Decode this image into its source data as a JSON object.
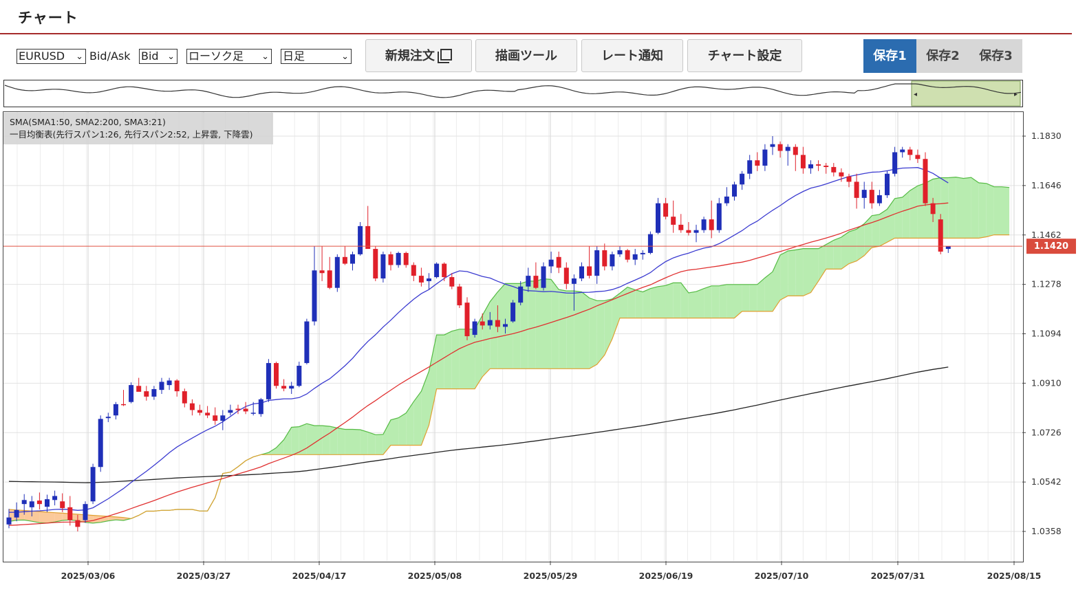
{
  "header": {
    "title": "チャート"
  },
  "toolbar": {
    "symbol": "EURUSD",
    "bidask_label": "Bid/Ask",
    "bidask": "Bid",
    "chart_type": "ローソク足",
    "timeframe": "日足",
    "buttons": {
      "new_order": "新規注文",
      "draw_tools": "描画ツール",
      "rate_alert": "レート通知",
      "chart_settings": "チャート設定"
    },
    "saves": [
      "保存1",
      "保存2",
      "保存3"
    ]
  },
  "legend": {
    "sma": "SMA(SMA1:50, SMA2:200, SMA3:21)",
    "ichimoku": "一目均衡表(先行スパン1:26, 先行スパン2:52, 上昇雲, 下降雲)"
  },
  "colors": {
    "up": "#1f2fb8",
    "down": "#e0202a",
    "sma21": "#3a3ad0",
    "sma50": "#e03030",
    "sma200": "#222222",
    "cloud_up": "#b8ecb0",
    "cloud_down": "#fbc99a",
    "span1": "#55bb44",
    "span2": "#e0a030",
    "price_line": "#e05040",
    "price_tag": "#d94b3d"
  },
  "chart_data": {
    "type": "candlestick",
    "title": "",
    "current_price": "1.1420",
    "y_ticks": [
      "1.1830",
      "1.1646",
      "1.1462",
      "1.1278",
      "1.1094",
      "1.0910",
      "1.0726",
      "1.0542",
      "1.0358"
    ],
    "ylim": [
      1.0248,
      1.1938
    ],
    "x_ticks": [
      "2025/03/06",
      "2025/03/27",
      "2025/04/17",
      "2025/05/08",
      "2025/05/29",
      "2025/06/19",
      "2025/07/10",
      "2025/07/31",
      "2025/08/15"
    ],
    "grid": true,
    "candles": [
      [
        1.0384,
        1.0442,
        1.037,
        1.041
      ],
      [
        1.041,
        1.0466,
        1.0396,
        1.0438
      ],
      [
        1.046,
        1.0497,
        1.042,
        1.0475
      ],
      [
        1.0448,
        1.049,
        1.0414,
        1.047
      ],
      [
        1.0473,
        1.0503,
        1.044,
        1.046
      ],
      [
        1.045,
        1.0495,
        1.043,
        1.0478
      ],
      [
        1.0475,
        1.051,
        1.0455,
        1.049
      ],
      [
        1.047,
        1.05,
        1.043,
        1.0445
      ],
      [
        1.0448,
        1.049,
        1.038,
        1.04
      ],
      [
        1.04,
        1.042,
        1.0358,
        1.0375
      ],
      [
        1.04,
        1.047,
        1.039,
        1.046
      ],
      [
        1.047,
        1.061,
        1.046,
        1.0598
      ],
      [
        1.0598,
        1.079,
        1.058,
        1.0777
      ],
      [
        1.078,
        1.08,
        1.0765,
        1.0785
      ],
      [
        1.079,
        1.084,
        1.0775,
        1.0832
      ],
      [
        1.0832,
        1.0885,
        1.0825,
        1.083
      ],
      [
        1.084,
        1.0913,
        1.0835,
        1.0903
      ],
      [
        1.09,
        1.093,
        1.088,
        1.0878
      ],
      [
        1.088,
        1.09,
        1.0845,
        1.086
      ],
      [
        1.086,
        1.09,
        1.0848,
        1.0888
      ],
      [
        1.0885,
        1.093,
        1.087,
        1.0915
      ],
      [
        1.0903,
        1.093,
        1.0885,
        1.092
      ],
      [
        1.092,
        1.0925,
        1.086,
        1.088
      ],
      [
        1.088,
        1.089,
        1.082,
        1.0835
      ],
      [
        1.0835,
        1.085,
        1.079,
        1.081
      ],
      [
        1.081,
        1.083,
        1.079,
        1.08
      ],
      [
        1.08,
        1.0825,
        1.078,
        1.079
      ],
      [
        1.079,
        1.082,
        1.0755,
        1.077
      ],
      [
        1.077,
        1.081,
        1.0735,
        1.079
      ],
      [
        1.08,
        1.083,
        1.079,
        1.081
      ],
      [
        1.0815,
        1.083,
        1.0795,
        1.081
      ],
      [
        1.0815,
        1.084,
        1.0795,
        1.0805
      ],
      [
        1.08,
        1.084,
        1.079,
        1.08
      ],
      [
        1.0795,
        1.0855,
        1.0785,
        1.085
      ],
      [
        1.085,
        1.1,
        1.084,
        1.0985
      ],
      [
        1.0985,
        1.099,
        1.089,
        1.09
      ],
      [
        1.09,
        1.0925,
        1.088,
        1.089
      ],
      [
        1.089,
        1.0915,
        1.087,
        1.09
      ],
      [
        1.09,
        1.099,
        1.0895,
        1.0975
      ],
      [
        1.0985,
        1.115,
        1.098,
        1.114
      ],
      [
        1.114,
        1.142,
        1.1125,
        1.133
      ],
      [
        1.133,
        1.142,
        1.129,
        1.132
      ],
      [
        1.133,
        1.138,
        1.126,
        1.1265
      ],
      [
        1.1265,
        1.139,
        1.125,
        1.138
      ],
      [
        1.138,
        1.142,
        1.135,
        1.1355
      ],
      [
        1.1355,
        1.14,
        1.133,
        1.139
      ],
      [
        1.139,
        1.151,
        1.1385,
        1.1495
      ],
      [
        1.1495,
        1.157,
        1.143,
        1.141
      ],
      [
        1.141,
        1.142,
        1.129,
        1.13
      ],
      [
        1.13,
        1.14,
        1.1285,
        1.139
      ],
      [
        1.139,
        1.14,
        1.133,
        1.135
      ],
      [
        1.135,
        1.14,
        1.134,
        1.1395
      ],
      [
        1.1395,
        1.14,
        1.134,
        1.135
      ],
      [
        1.135,
        1.136,
        1.129,
        1.131
      ],
      [
        1.131,
        1.134,
        1.127,
        1.1285
      ],
      [
        1.129,
        1.132,
        1.126,
        1.13
      ],
      [
        1.1305,
        1.136,
        1.13,
        1.1355
      ],
      [
        1.1355,
        1.136,
        1.129,
        1.1305
      ],
      [
        1.1305,
        1.132,
        1.126,
        1.127
      ],
      [
        1.127,
        1.128,
        1.119,
        1.12
      ],
      [
        1.121,
        1.123,
        1.107,
        1.1085
      ],
      [
        1.109,
        1.115,
        1.108,
        1.114
      ],
      [
        1.114,
        1.117,
        1.111,
        1.1125
      ],
      [
        1.1125,
        1.1175,
        1.111,
        1.1145
      ],
      [
        1.1145,
        1.12,
        1.11,
        1.112
      ],
      [
        1.112,
        1.115,
        1.1095,
        1.113
      ],
      [
        1.114,
        1.122,
        1.1135,
        1.121
      ],
      [
        1.121,
        1.129,
        1.12,
        1.127
      ],
      [
        1.127,
        1.134,
        1.125,
        1.131
      ],
      [
        1.131,
        1.136,
        1.126,
        1.1265
      ],
      [
        1.1265,
        1.136,
        1.1255,
        1.1345
      ],
      [
        1.1345,
        1.14,
        1.132,
        1.137
      ],
      [
        1.138,
        1.14,
        1.132,
        1.134
      ],
      [
        1.134,
        1.136,
        1.126,
        1.128
      ],
      [
        1.128,
        1.1315,
        1.118,
        1.13
      ],
      [
        1.13,
        1.136,
        1.129,
        1.1345
      ],
      [
        1.1345,
        1.142,
        1.13,
        1.131
      ],
      [
        1.131,
        1.142,
        1.128,
        1.1405
      ],
      [
        1.1405,
        1.143,
        1.133,
        1.1345
      ],
      [
        1.1345,
        1.14,
        1.133,
        1.139
      ],
      [
        1.139,
        1.142,
        1.138,
        1.1405
      ],
      [
        1.1405,
        1.141,
        1.136,
        1.137
      ],
      [
        1.137,
        1.141,
        1.135,
        1.139
      ],
      [
        1.139,
        1.1405,
        1.137,
        1.1395
      ],
      [
        1.1395,
        1.1475,
        1.139,
        1.1465
      ],
      [
        1.147,
        1.16,
        1.1465,
        1.158
      ],
      [
        1.158,
        1.16,
        1.152,
        1.153
      ],
      [
        1.153,
        1.159,
        1.147,
        1.15
      ],
      [
        1.15,
        1.154,
        1.147,
        1.148
      ],
      [
        1.148,
        1.151,
        1.146,
        1.147
      ],
      [
        1.147,
        1.15,
        1.1435,
        1.148
      ],
      [
        1.148,
        1.153,
        1.147,
        1.152
      ],
      [
        1.152,
        1.159,
        1.145,
        1.148
      ],
      [
        1.148,
        1.16,
        1.147,
        1.158
      ],
      [
        1.158,
        1.164,
        1.157,
        1.1605
      ],
      [
        1.1605,
        1.166,
        1.159,
        1.165
      ],
      [
        1.165,
        1.17,
        1.163,
        1.169
      ],
      [
        1.169,
        1.176,
        1.167,
        1.174
      ],
      [
        1.174,
        1.177,
        1.17,
        1.172
      ],
      [
        1.172,
        1.18,
        1.17,
        1.178
      ],
      [
        1.179,
        1.183,
        1.176,
        1.18
      ],
      [
        1.18,
        1.181,
        1.175,
        1.1775
      ],
      [
        1.1775,
        1.18,
        1.172,
        1.179
      ],
      [
        1.179,
        1.18,
        1.17,
        1.176
      ],
      [
        1.176,
        1.179,
        1.169,
        1.171
      ],
      [
        1.171,
        1.174,
        1.169,
        1.1725
      ],
      [
        1.1725,
        1.174,
        1.17,
        1.172
      ],
      [
        1.172,
        1.173,
        1.169,
        1.1715
      ],
      [
        1.1715,
        1.173,
        1.168,
        1.1695
      ],
      [
        1.1695,
        1.171,
        1.166,
        1.168
      ],
      [
        1.168,
        1.169,
        1.164,
        1.166
      ],
      [
        1.166,
        1.169,
        1.156,
        1.16
      ],
      [
        1.16,
        1.166,
        1.156,
        1.163
      ],
      [
        1.163,
        1.166,
        1.156,
        1.158
      ],
      [
        1.158,
        1.163,
        1.157,
        1.161
      ],
      [
        1.161,
        1.17,
        1.16,
        1.169
      ],
      [
        1.169,
        1.179,
        1.168,
        1.177
      ],
      [
        1.177,
        1.179,
        1.175,
        1.178
      ],
      [
        1.178,
        1.179,
        1.174,
        1.176
      ],
      [
        1.176,
        1.178,
        1.173,
        1.1745
      ],
      [
        1.1745,
        1.177,
        1.157,
        1.158
      ],
      [
        1.158,
        1.16,
        1.151,
        1.154
      ],
      [
        1.152,
        1.154,
        1.139,
        1.14
      ],
      [
        1.141,
        1.142,
        1.1395,
        1.142
      ]
    ]
  }
}
